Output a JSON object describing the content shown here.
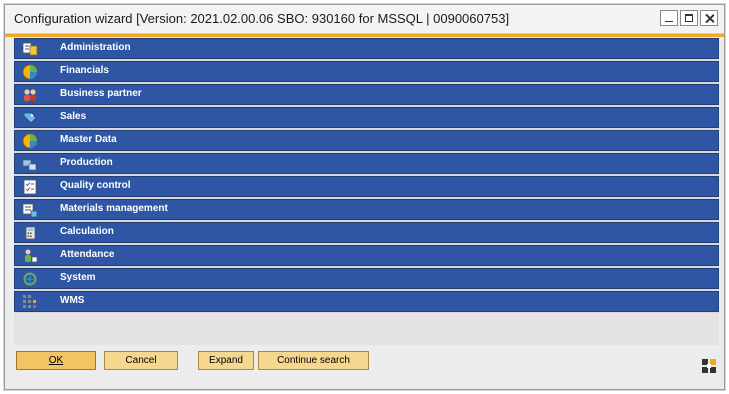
{
  "window": {
    "title": "Configuration wizard [Version: 2021.02.00.06 SBO: 930160 for MSSQL | 0090060753]"
  },
  "menu_items": [
    {
      "label": "Administration",
      "icon": "administration-icon"
    },
    {
      "label": "Financials",
      "icon": "financials-icon"
    },
    {
      "label": "Business partner",
      "icon": "business-partner-icon"
    },
    {
      "label": "Sales",
      "icon": "sales-icon"
    },
    {
      "label": "Master Data",
      "icon": "master-data-icon"
    },
    {
      "label": "Production",
      "icon": "production-icon"
    },
    {
      "label": "Quality control",
      "icon": "quality-control-icon"
    },
    {
      "label": "Materials management",
      "icon": "materials-management-icon"
    },
    {
      "label": "Calculation",
      "icon": "calculation-icon"
    },
    {
      "label": "Attendance",
      "icon": "attendance-icon"
    },
    {
      "label": "System",
      "icon": "system-icon"
    },
    {
      "label": "WMS",
      "icon": "wms-icon"
    }
  ],
  "buttons": {
    "ok": "OK",
    "cancel": "Cancel",
    "expand": "Expand",
    "continue_search": "Continue search"
  },
  "colors": {
    "row_blue": "#2e56a4",
    "accent_orange": "#f1a825",
    "button_yellow": "#f5d78f"
  }
}
